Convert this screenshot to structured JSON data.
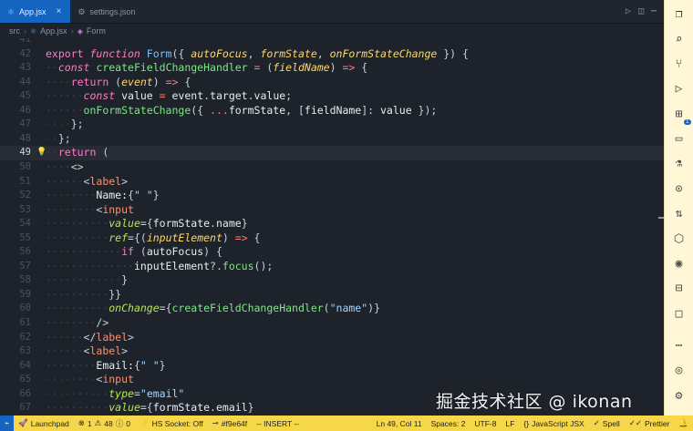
{
  "tabs": [
    {
      "label": "App.jsx",
      "active": true
    },
    {
      "label": "settings.json",
      "active": false
    }
  ],
  "breadcrumb": [
    "src",
    "App.jsx",
    "Form"
  ],
  "code_lines": [
    {
      "n": "41",
      "tokens": []
    },
    {
      "n": "42",
      "tokens": [
        [
          "kw2",
          "export "
        ],
        [
          "kw",
          "function "
        ],
        [
          "fn2",
          "Form"
        ],
        [
          "pun",
          "({ "
        ],
        [
          "param",
          "autoFocus"
        ],
        [
          "pun",
          ", "
        ],
        [
          "param",
          "formState"
        ],
        [
          "pun",
          ", "
        ],
        [
          "param",
          "onFormStateChange"
        ],
        [
          "pun",
          " }) {"
        ]
      ]
    },
    {
      "n": "43",
      "tokens": [
        [
          "ws",
          "··"
        ],
        [
          "kw",
          "const "
        ],
        [
          "fn",
          "createFieldChangeHandler"
        ],
        [
          "op",
          " = "
        ],
        [
          "pun",
          "("
        ],
        [
          "param",
          "fieldName"
        ],
        [
          "pun",
          ")"
        ],
        [
          "op",
          " => "
        ],
        [
          "pun",
          "{"
        ]
      ]
    },
    {
      "n": "44",
      "tokens": [
        [
          "ws",
          "····"
        ],
        [
          "kw2",
          "return "
        ],
        [
          "pun",
          "("
        ],
        [
          "param",
          "event"
        ],
        [
          "pun",
          ")"
        ],
        [
          "op",
          " => "
        ],
        [
          "pun",
          "{"
        ]
      ]
    },
    {
      "n": "45",
      "tokens": [
        [
          "ws",
          "······"
        ],
        [
          "kw",
          "const "
        ],
        [
          "var",
          "value"
        ],
        [
          "op",
          " = "
        ],
        [
          "var",
          "event"
        ],
        [
          "pun",
          "."
        ],
        [
          "var",
          "target"
        ],
        [
          "pun",
          "."
        ],
        [
          "var",
          "value"
        ],
        [
          "pun",
          ";"
        ]
      ]
    },
    {
      "n": "46",
      "tokens": [
        [
          "ws",
          "······"
        ],
        [
          "fn",
          "onFormStateChange"
        ],
        [
          "pun",
          "({ "
        ],
        [
          "op",
          "..."
        ],
        [
          "var",
          "formState"
        ],
        [
          "pun",
          ", ["
        ],
        [
          "var",
          "fieldName"
        ],
        [
          "pun",
          "]: "
        ],
        [
          "var",
          "value"
        ],
        [
          "pun",
          " });"
        ]
      ]
    },
    {
      "n": "47",
      "tokens": [
        [
          "ws",
          "····"
        ],
        [
          "pun",
          "};"
        ]
      ]
    },
    {
      "n": "48",
      "tokens": [
        [
          "ws",
          "··"
        ],
        [
          "pun",
          "};"
        ]
      ]
    },
    {
      "n": "49",
      "current": true,
      "bulb": true,
      "tokens": [
        [
          "ws",
          "··"
        ],
        [
          "kw2",
          "return "
        ],
        [
          "pun",
          "("
        ]
      ]
    },
    {
      "n": "50",
      "tokens": [
        [
          "ws",
          "····"
        ],
        [
          "pun",
          "<>"
        ]
      ]
    },
    {
      "n": "51",
      "tokens": [
        [
          "ws",
          "······"
        ],
        [
          "pun",
          "<"
        ],
        [
          "tag",
          "label"
        ],
        [
          "pun",
          ">"
        ]
      ]
    },
    {
      "n": "52",
      "tokens": [
        [
          "ws",
          "········"
        ],
        [
          "var",
          "Name:"
        ],
        [
          "pun",
          "{"
        ],
        [
          "str",
          "\" \""
        ],
        [
          "pun",
          "}"
        ]
      ]
    },
    {
      "n": "53",
      "tokens": [
        [
          "ws",
          "········"
        ],
        [
          "pun",
          "<"
        ],
        [
          "tag",
          "input"
        ]
      ]
    },
    {
      "n": "54",
      "tokens": [
        [
          "ws",
          "··········"
        ],
        [
          "attr",
          "value"
        ],
        [
          "pun",
          "={"
        ],
        [
          "var",
          "formState"
        ],
        [
          "pun",
          "."
        ],
        [
          "var",
          "name"
        ],
        [
          "pun",
          "}"
        ]
      ]
    },
    {
      "n": "55",
      "tokens": [
        [
          "ws",
          "··········"
        ],
        [
          "attr",
          "ref"
        ],
        [
          "pun",
          "={("
        ],
        [
          "param",
          "inputElement"
        ],
        [
          "pun",
          ")"
        ],
        [
          "op",
          " => "
        ],
        [
          "pun",
          "{"
        ]
      ]
    },
    {
      "n": "56",
      "tokens": [
        [
          "ws",
          "············"
        ],
        [
          "kw2",
          "if "
        ],
        [
          "pun",
          "("
        ],
        [
          "var",
          "autoFocus"
        ],
        [
          "pun",
          ") {"
        ]
      ]
    },
    {
      "n": "57",
      "tokens": [
        [
          "ws",
          "··············"
        ],
        [
          "var",
          "inputElement"
        ],
        [
          "pun",
          "?."
        ],
        [
          "fn",
          "focus"
        ],
        [
          "pun",
          "();"
        ]
      ]
    },
    {
      "n": "58",
      "tokens": [
        [
          "ws",
          "············"
        ],
        [
          "pun",
          "}"
        ]
      ]
    },
    {
      "n": "59",
      "tokens": [
        [
          "ws",
          "··········"
        ],
        [
          "pun",
          "}}"
        ]
      ]
    },
    {
      "n": "60",
      "tokens": [
        [
          "ws",
          "··········"
        ],
        [
          "attr",
          "onChange"
        ],
        [
          "pun",
          "={"
        ],
        [
          "fn",
          "createFieldChangeHandler"
        ],
        [
          "pun",
          "("
        ],
        [
          "str",
          "\"name\""
        ],
        [
          "pun",
          ")}"
        ]
      ]
    },
    {
      "n": "61",
      "tokens": [
        [
          "ws",
          "········"
        ],
        [
          "pun",
          "/>"
        ]
      ]
    },
    {
      "n": "62",
      "tokens": [
        [
          "ws",
          "······"
        ],
        [
          "pun",
          "</"
        ],
        [
          "tag",
          "label"
        ],
        [
          "pun",
          ">"
        ]
      ]
    },
    {
      "n": "63",
      "tokens": [
        [
          "ws",
          "······"
        ],
        [
          "pun",
          "<"
        ],
        [
          "tag",
          "label"
        ],
        [
          "pun",
          ">"
        ]
      ]
    },
    {
      "n": "64",
      "tokens": [
        [
          "ws",
          "········"
        ],
        [
          "var",
          "Email:"
        ],
        [
          "pun",
          "{"
        ],
        [
          "str",
          "\" \""
        ],
        [
          "pun",
          "}"
        ]
      ]
    },
    {
      "n": "65",
      "tokens": [
        [
          "ws",
          "········"
        ],
        [
          "pun",
          "<"
        ],
        [
          "tag",
          "input"
        ]
      ]
    },
    {
      "n": "66",
      "tokens": [
        [
          "ws",
          "··········"
        ],
        [
          "attr",
          "type"
        ],
        [
          "pun",
          "="
        ],
        [
          "str",
          "\"email\""
        ]
      ]
    },
    {
      "n": "67",
      "tokens": [
        [
          "ws",
          "··········"
        ],
        [
          "attr",
          "value"
        ],
        [
          "pun",
          "={"
        ],
        [
          "var",
          "formState"
        ],
        [
          "pun",
          "."
        ],
        [
          "var",
          "email"
        ],
        [
          "pun",
          "}"
        ]
      ]
    }
  ],
  "activitybar": [
    {
      "icon": "files-icon"
    },
    {
      "icon": "search-icon"
    },
    {
      "icon": "source-control-icon"
    },
    {
      "icon": "run-debug-icon"
    },
    {
      "icon": "extensions-icon",
      "badge": "1"
    },
    {
      "icon": "remote-explorer-icon"
    },
    {
      "icon": "testing-icon"
    },
    {
      "icon": "git-graph-icon"
    },
    {
      "icon": "pull-request-icon"
    },
    {
      "icon": "package-icon"
    },
    {
      "icon": "github-icon"
    },
    {
      "icon": "terminal-icon"
    },
    {
      "icon": "square-icon"
    },
    {
      "icon": "more-icon"
    }
  ],
  "status": {
    "remote": "⌁",
    "launchpad": "Launchpad",
    "errors": "1",
    "warnings": "0",
    "ports_label": "48",
    "info": "0",
    "hs_socket": "HS Socket: Off",
    "commit": "#f9e64f",
    "mode": "-- INSERT --",
    "position": "Ln 49, Col 11",
    "spaces": "Spaces: 2",
    "encoding": "UTF-8",
    "eol": "LF",
    "language": "JavaScript JSX",
    "spell": "Spell",
    "prettier": "Prettier"
  },
  "watermark": "掘金技术社区 @ ikonan",
  "colors": {
    "accent": "#1565c0",
    "statusbar": "#f6d74a",
    "editor_bg": "#1e222a"
  }
}
